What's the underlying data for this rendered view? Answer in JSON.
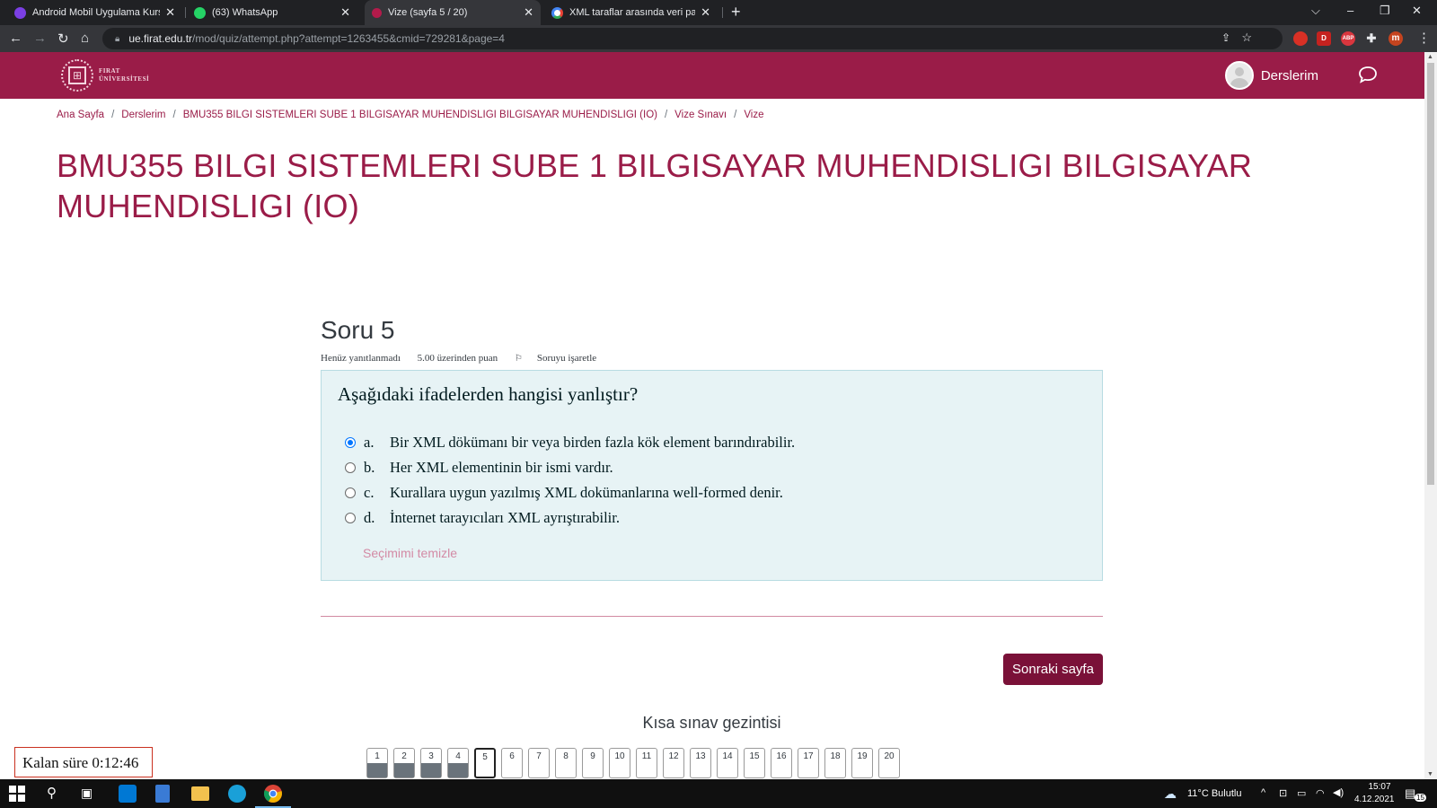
{
  "browser": {
    "tabs": [
      {
        "title": "Android Mobil Uygulama Kursu:",
        "favicon_color": "#7b3fe4"
      },
      {
        "title": "(63) WhatsApp",
        "favicon_color": "#25d366"
      },
      {
        "title": "Vize (sayfa 5 / 20)",
        "favicon_color": "#b31b4b",
        "active": true
      },
      {
        "title": "XML taraflar arasında veri paylaşı",
        "favicon_color": "#ffffff"
      }
    ],
    "url_host": "ue.firat.edu.tr",
    "url_path": "/mod/quiz/attempt.php?attempt=1263455&cmid=729281&page=4",
    "extensions": [
      {
        "label": "",
        "color": "#d93025"
      },
      {
        "label": "D",
        "color": "#c5221f"
      },
      {
        "label": "ABP",
        "color": "#d9363e"
      },
      {
        "label": "",
        "color": "#5f6368"
      },
      {
        "label": "m",
        "color": "#c5441f"
      }
    ]
  },
  "site": {
    "logo_line1": "FIRAT",
    "logo_line2": "ÜNİVERSİTESİ",
    "brand_color": "#9a1c48",
    "user_menu": "Derslerim"
  },
  "breadcrumb": [
    "Ana Sayfa",
    "Derslerim",
    "BMU355 BILGI SISTEMLERI SUBE 1 BILGISAYAR MUHENDISLIGI BILGISAYAR MUHENDISLIGI (IO)",
    "Vize Sınavı",
    "Vize"
  ],
  "course_title": "BMU355 BILGI SISTEMLERI SUBE 1 BILGISAYAR MUHENDISLIGI BILGISAYAR MUHENDISLIGI (IO)",
  "question": {
    "heading": "Soru 5",
    "status": "Henüz yanıtlanmadı",
    "points": "5.00 üzerinden puan",
    "flag_label": "Soruyu işaretle",
    "text": "Aşağıdaki ifadelerden hangisi yanlıştır?",
    "answers": [
      {
        "letter": "a.",
        "text": "Bir XML dökümanı bir veya birden fazla kök element barındırabilir.",
        "selected": true
      },
      {
        "letter": "b.",
        "text": "Her XML elementinin bir ismi vardır.",
        "selected": false
      },
      {
        "letter": "c.",
        "text": "Kurallara uygun yazılmış XML dokümanlarına well-formed denir.",
        "selected": false
      },
      {
        "letter": "d.",
        "text": "İnternet tarayıcıları XML ayrıştırabilir.",
        "selected": false
      }
    ],
    "clear_label": "Seçimimi temizle"
  },
  "next_button": "Sonraki sayfa",
  "quiz_nav": {
    "title": "Kısa sınav gezintisi",
    "current": 5,
    "answered": [
      1,
      2,
      3,
      4
    ],
    "buttons": [
      "1",
      "2",
      "3",
      "4",
      "5",
      "6",
      "7",
      "8",
      "9",
      "10",
      "11",
      "12",
      "13",
      "14",
      "15",
      "16",
      "17",
      "18",
      "19",
      "20"
    ]
  },
  "timer": "Kalan süre 0:12:46",
  "taskbar": {
    "weather": "11°C  Bulutlu",
    "time": "15:07",
    "date": "4.12.2021",
    "notifications": "15"
  }
}
